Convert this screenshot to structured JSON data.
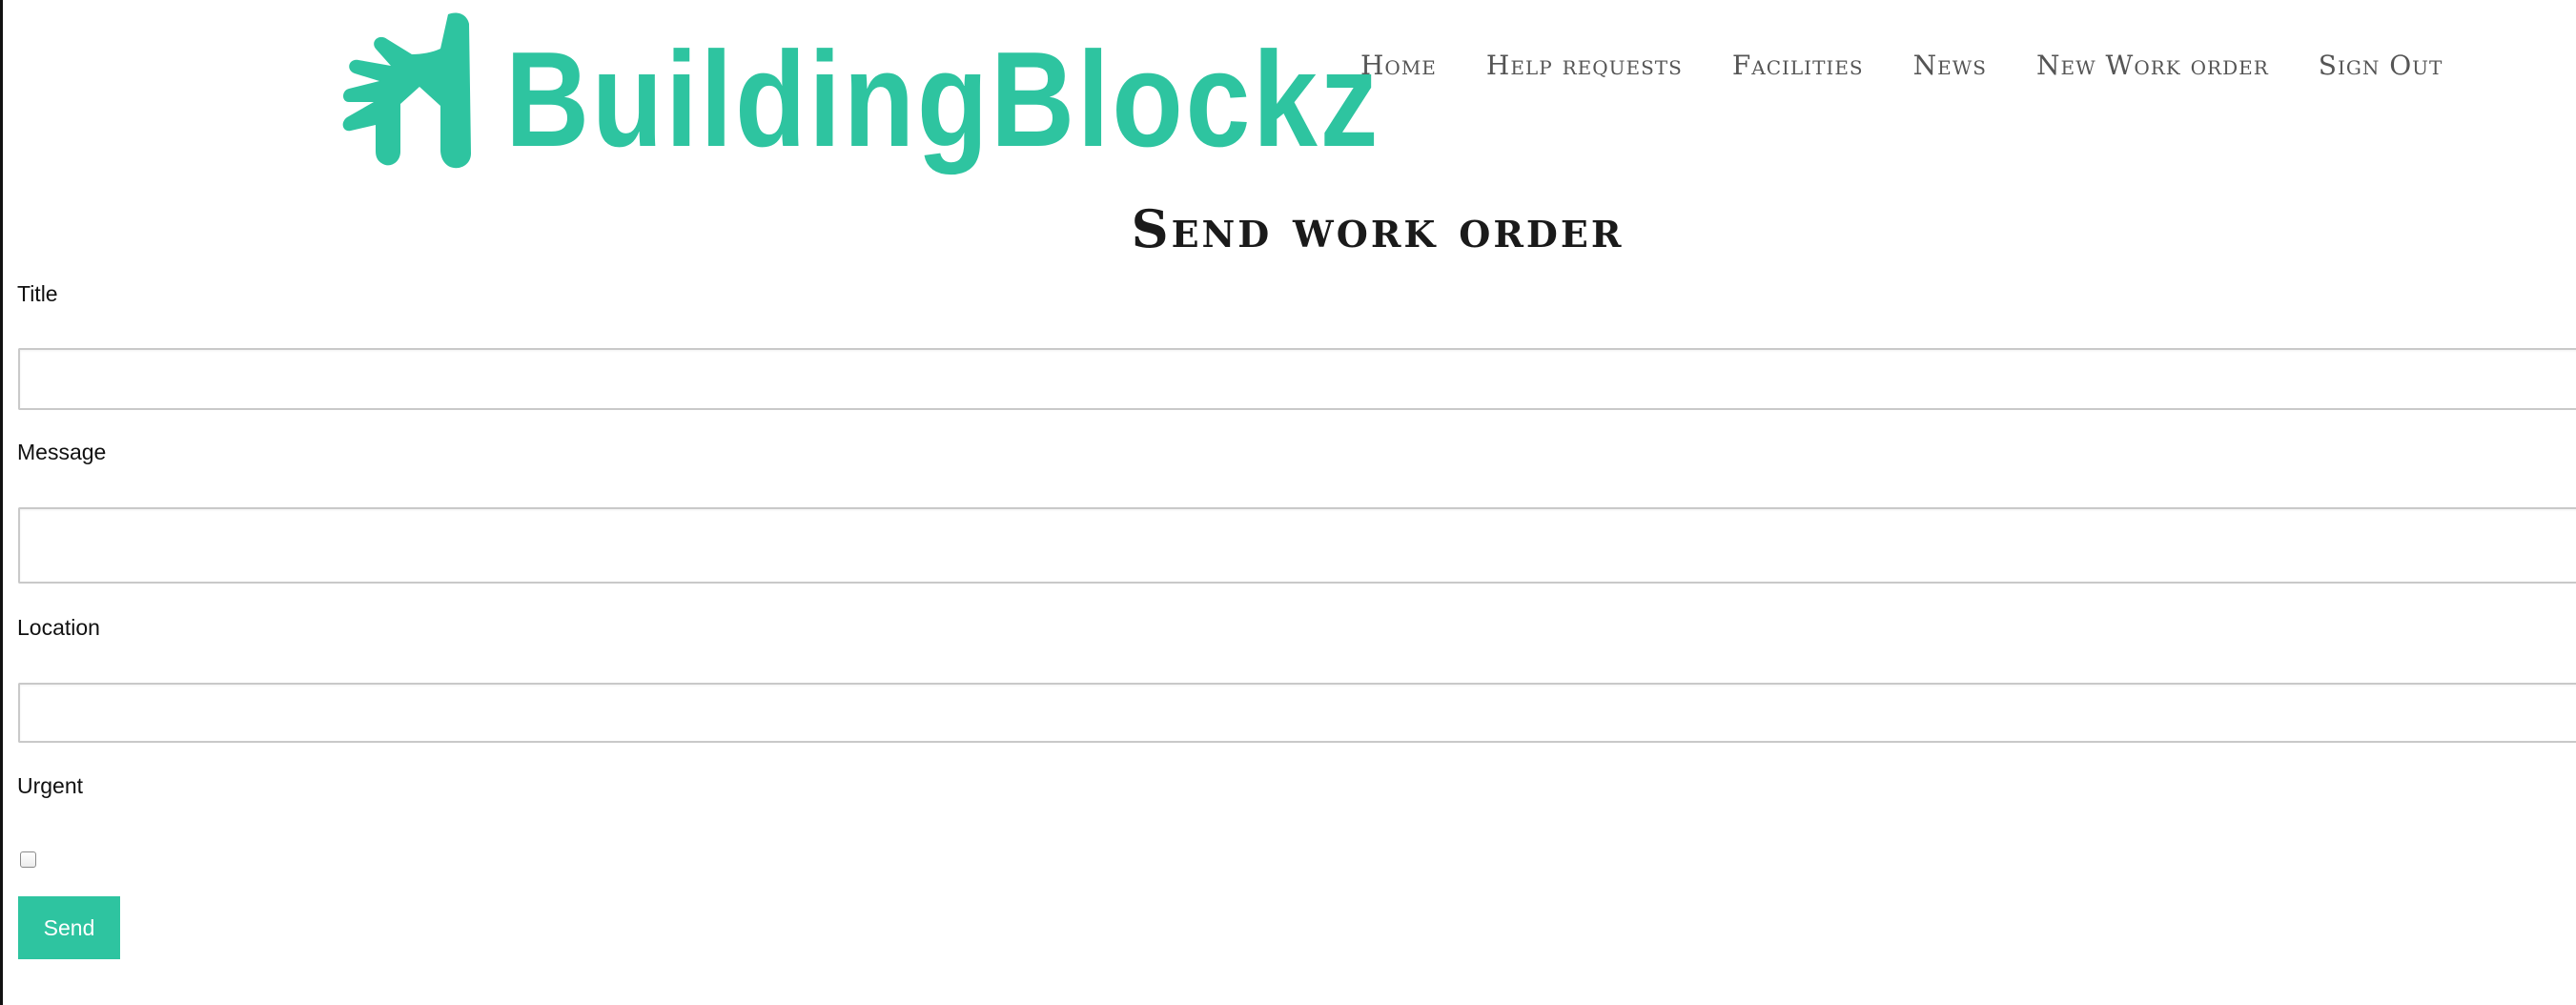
{
  "brand": {
    "name": "BuildingBlockz",
    "color": "#2ec4a0"
  },
  "nav": {
    "items": [
      {
        "label": "Home"
      },
      {
        "label": "Help requests"
      },
      {
        "label": "Facilities"
      },
      {
        "label": "News"
      },
      {
        "label": "New Work order"
      },
      {
        "label": "Sign Out"
      }
    ]
  },
  "page": {
    "title": "Send work order"
  },
  "form": {
    "title_label": "Title",
    "title_value": "",
    "message_label": "Message",
    "message_value": "",
    "location_label": "Location",
    "location_value": "",
    "urgent_label": "Urgent",
    "urgent_checked": false,
    "submit_label": "Send"
  }
}
